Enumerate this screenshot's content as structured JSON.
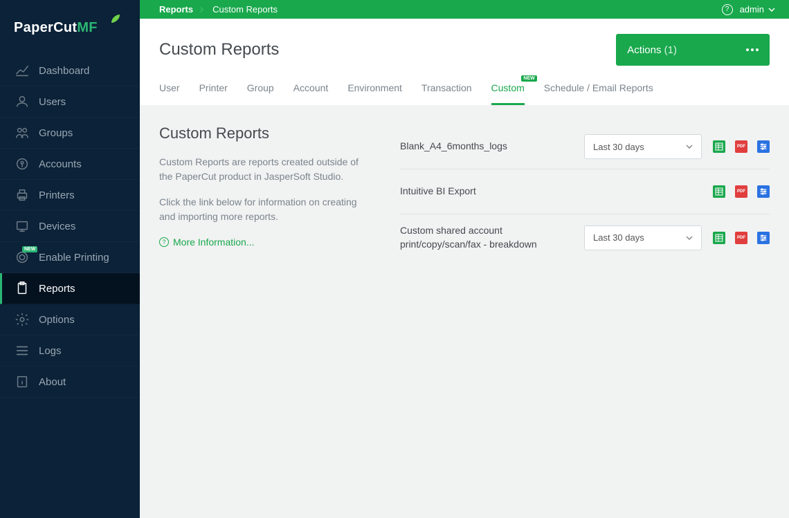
{
  "logo": {
    "brand": "PaperCut",
    "suffix": "MF"
  },
  "breadcrumb": {
    "root": "Reports",
    "leaf": "Custom Reports"
  },
  "topbar": {
    "user": "admin"
  },
  "page_title": "Custom Reports",
  "actions_btn": {
    "label": "Actions ",
    "count": "(1)"
  },
  "sidebar": {
    "items": [
      {
        "key": "dashboard",
        "label": "Dashboard"
      },
      {
        "key": "users",
        "label": "Users"
      },
      {
        "key": "groups",
        "label": "Groups"
      },
      {
        "key": "accounts",
        "label": "Accounts"
      },
      {
        "key": "printers",
        "label": "Printers"
      },
      {
        "key": "devices",
        "label": "Devices"
      },
      {
        "key": "enable-printing",
        "label": "Enable Printing",
        "new": true
      },
      {
        "key": "reports",
        "label": "Reports",
        "active": true
      },
      {
        "key": "options",
        "label": "Options"
      },
      {
        "key": "logs",
        "label": "Logs"
      },
      {
        "key": "about",
        "label": "About"
      }
    ],
    "new_badge": "NEW"
  },
  "tabs": [
    {
      "key": "user",
      "label": "User"
    },
    {
      "key": "printer",
      "label": "Printer"
    },
    {
      "key": "group",
      "label": "Group"
    },
    {
      "key": "account",
      "label": "Account"
    },
    {
      "key": "environment",
      "label": "Environment"
    },
    {
      "key": "transaction",
      "label": "Transaction"
    },
    {
      "key": "custom",
      "label": "Custom",
      "active": true,
      "new": true,
      "new_text": "NEW"
    },
    {
      "key": "schedule",
      "label": "Schedule / Email Reports"
    }
  ],
  "left": {
    "heading": "Custom Reports",
    "para1": "Custom Reports are reports created outside of the PaperCut product in JasperSoft Studio.",
    "para2": "Click the link below for information on creating and importing more reports.",
    "more_info": "More Information..."
  },
  "reports": [
    {
      "name": "Blank_A4_6months_logs",
      "period": "Last 30 days",
      "has_period": true
    },
    {
      "name": "Intuitive BI Export",
      "period": "",
      "has_period": false
    },
    {
      "name": "Custom shared account print/copy/scan/fax - breakdown",
      "period": "Last 30 days",
      "has_period": true
    }
  ],
  "icons": {
    "pdf_text": "PDF"
  }
}
